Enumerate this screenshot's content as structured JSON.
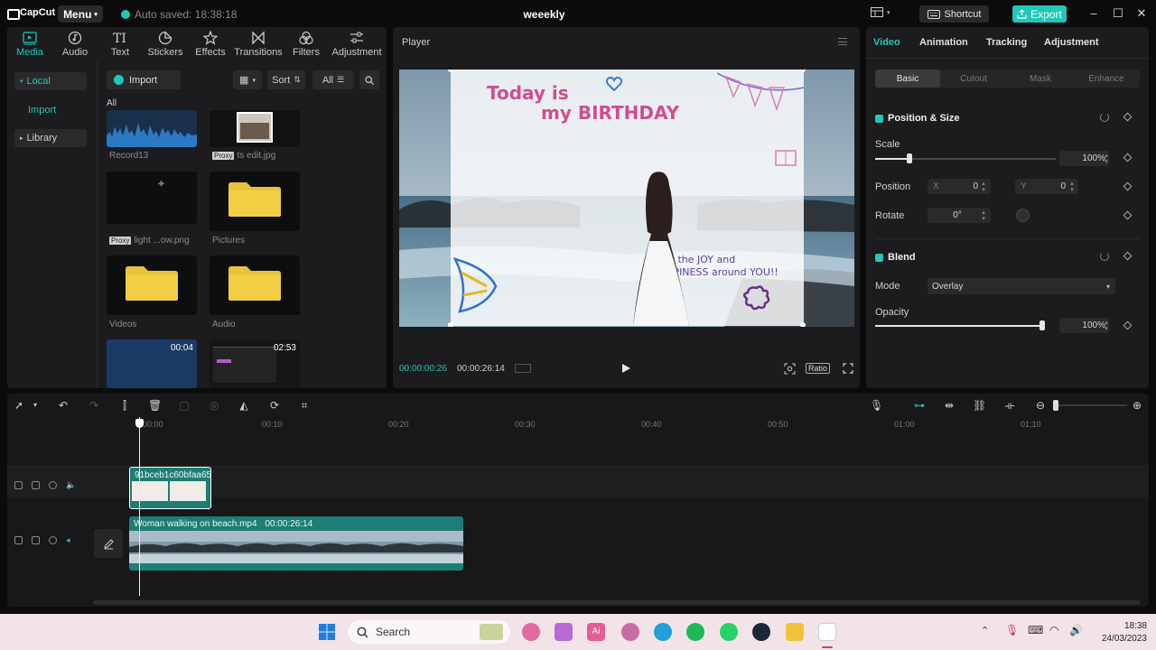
{
  "titlebar": {
    "app_name": "CapCut",
    "menu_label": "Menu",
    "autosave_text": "Auto saved: 18:38:18",
    "project_title": "weeekly",
    "shortcut_label": "Shortcut",
    "export_label": "Export"
  },
  "tool_tabs": [
    {
      "label": "Media",
      "icon": "media-icon",
      "active": true
    },
    {
      "label": "Audio",
      "icon": "audio-icon"
    },
    {
      "label": "Text",
      "icon": "text-icon"
    },
    {
      "label": "Stickers",
      "icon": "stickers-icon"
    },
    {
      "label": "Effects",
      "icon": "effects-icon"
    },
    {
      "label": "Transitions",
      "icon": "transitions-icon"
    },
    {
      "label": "Filters",
      "icon": "filters-icon"
    },
    {
      "label": "Adjustment",
      "icon": "adjustment-icon"
    }
  ],
  "side_nav": {
    "local": "Local",
    "import": "Import",
    "library": "Library"
  },
  "media": {
    "import_label": "Import",
    "sort_label": "Sort",
    "all_filter": "All",
    "section_label": "All",
    "proxy_badge": "Proxy",
    "items": [
      {
        "name": "Record13",
        "type": "audio"
      },
      {
        "name": "ts edit.jpg",
        "type": "image",
        "proxy": true
      },
      {
        "name": "light ...ow.png",
        "type": "image",
        "proxy": true
      },
      {
        "name": "Pictures",
        "type": "folder"
      },
      {
        "name": "Videos",
        "type": "folder"
      },
      {
        "name": "Audio",
        "type": "folder"
      },
      {
        "name": "",
        "type": "audio",
        "duration": "00:04"
      },
      {
        "name": "",
        "type": "video",
        "duration": "02:53"
      }
    ]
  },
  "player": {
    "title": "Player",
    "current_time": "00:00:00:26",
    "total_time": "00:00:26:14",
    "ratio_label": "Ratio",
    "overlay_line1": "Today is",
    "overlay_line2": "my BIRTHDAY",
    "overlay_line3": "may the JOY and HAPPINESS around YOU!!"
  },
  "properties": {
    "tabs": [
      "Video",
      "Animation",
      "Tracking",
      "Adjustment"
    ],
    "active_tab": "Video",
    "sub_tabs": [
      "Basic",
      "Cutout",
      "Mask",
      "Enhance"
    ],
    "active_sub_tab": "Basic",
    "position_size_title": "Position & Size",
    "scale_label": "Scale",
    "scale_value": "100%",
    "scale_fraction": 0.19,
    "position_label": "Position",
    "x_label": "X",
    "x_value": "0",
    "y_label": "Y",
    "y_value": "0",
    "rotate_label": "Rotate",
    "rotate_value": "0°",
    "blend_title": "Blend",
    "mode_label": "Mode",
    "mode_value": "Overlay",
    "opacity_label": "Opacity",
    "opacity_value": "100%",
    "opacity_fraction": 1.0
  },
  "timeline": {
    "ticks": [
      "00:00",
      "00:10",
      "00:20",
      "00:30",
      "00:40",
      "00:50",
      "01:00",
      "01:10"
    ],
    "overlay_clip_name": "91bceb1c60bfaa65",
    "main_clip_name": "Woman walking on beach.mp4",
    "main_clip_duration": "00:00:26:14"
  },
  "taskbar": {
    "search_placeholder": "Search",
    "time": "18:38",
    "date": "24/03/2023"
  },
  "colors": {
    "accent": "#21c7b7",
    "panel": "#1c1c1e",
    "clip": "#1e7d74"
  }
}
